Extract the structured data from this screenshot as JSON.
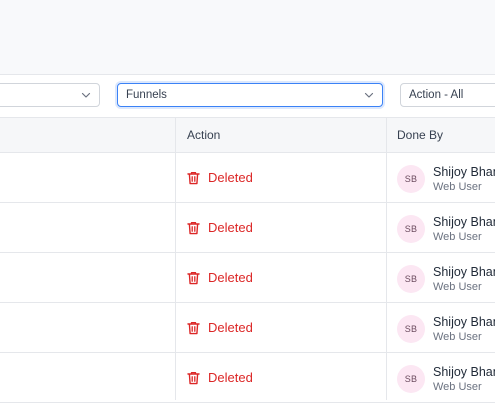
{
  "filters": {
    "first_select": {
      "value": ""
    },
    "type_select": {
      "value": "Funnels"
    },
    "action_select": {
      "value": "Action - All"
    }
  },
  "table": {
    "columns": {
      "action": "Action",
      "done_by": "Done By"
    },
    "rows": [
      {
        "action": "Deleted",
        "avatar": "SB",
        "user_name": "Shijoy Bhan",
        "user_role": "Web User"
      },
      {
        "action": "Deleted",
        "avatar": "SB",
        "user_name": "Shijoy Bhan",
        "user_role": "Web User"
      },
      {
        "action": "Deleted",
        "avatar": "SB",
        "user_name": "Shijoy Bhan",
        "user_role": "Web User"
      },
      {
        "action": "Deleted",
        "avatar": "SB",
        "user_name": "Shijoy Bhan",
        "user_role": "Web User"
      },
      {
        "action": "Deleted",
        "avatar": "SB",
        "user_name": "Shijoy Bhan",
        "user_role": "Web User"
      }
    ]
  },
  "colors": {
    "deleted": "#dc2626",
    "avatar_bg": "#fce7f3",
    "focus_border": "#3b82f6"
  },
  "icons": {
    "action": "trash-icon",
    "select": "chevron-down-icon"
  }
}
